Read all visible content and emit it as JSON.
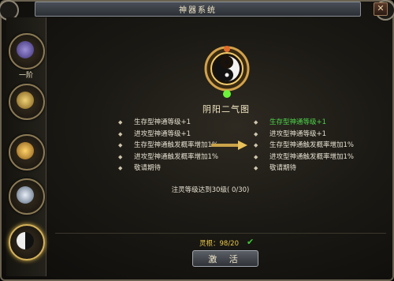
{
  "window": {
    "title": "神器系统",
    "close_label": "✕"
  },
  "sidebar": {
    "items": [
      {
        "label": "一阶",
        "icon": "lotus-artifact-icon",
        "active": false
      },
      {
        "label": "",
        "icon": "crown-artifact-icon",
        "active": false
      },
      {
        "label": "",
        "icon": "gear-artifact-icon",
        "active": false
      },
      {
        "label": "",
        "icon": "lotus-flower-artifact-icon",
        "active": false
      },
      {
        "label": "",
        "icon": "yin-yang-artifact-icon",
        "active": true
      }
    ]
  },
  "relic": {
    "name": "阴阳二气图",
    "icon": "yin-yang-relic-icon"
  },
  "current_attrs": [
    "生存型神通等级+1",
    "进攻型神通等级+1",
    "生存型神通触发概率增加1%",
    "进攻型神通触发概率增加1%",
    "敬请期待"
  ],
  "next_attrs": [
    "生存型神通等级+1",
    "进攻型神通等级+1",
    "生存型神通触发概率增加1%",
    "进攻型神通触发概率增加1%",
    "敬请期待"
  ],
  "condition": "注灵等级达到30级( 0/30)",
  "spirit": {
    "label": "灵根：98/20"
  },
  "activate_label": "激 活",
  "colors": {
    "highlight": "#4cd24a",
    "gold": "#e9c84a",
    "text": "#e4dfd0"
  }
}
